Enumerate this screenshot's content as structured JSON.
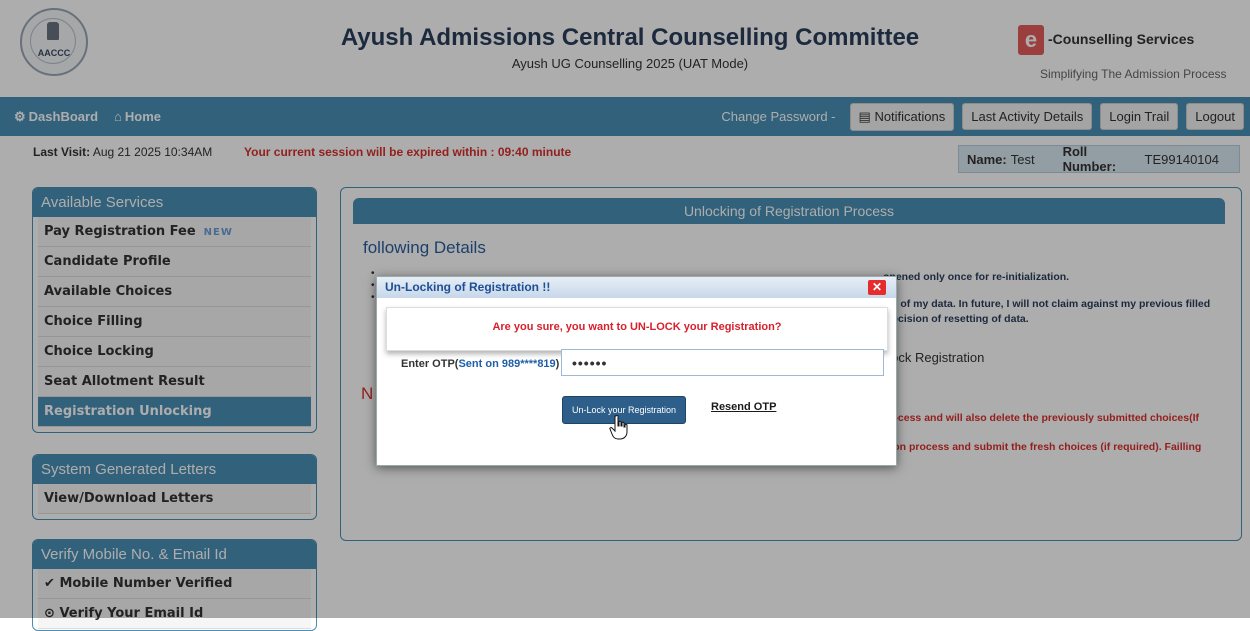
{
  "header": {
    "title": "Ayush Admissions Central Counselling Committee",
    "subtitle": "Ayush UG Counselling 2025 (UAT Mode)",
    "emblem_abbr": "AACCC",
    "brand_mark": "e",
    "brand_name": "-Counselling Services",
    "brand_tagline": "Simplifying The Admission Process"
  },
  "nav": {
    "dashboard": "DashBoard",
    "home": "Home",
    "change_password": "Change Password -",
    "notifications": "Notifications",
    "last_activity": "Last Activity Details",
    "login_trail": "Login Trail",
    "logout": "Logout"
  },
  "info": {
    "last_visit_label": "Last Visit:",
    "last_visit_value": "Aug 21 2025 10:34AM",
    "session_warning": "Your current session will be expired within : 09:40 minute",
    "name_label": "Name:",
    "name_value": "Test",
    "roll_label": "Roll Number:",
    "roll_value": "TE99140104"
  },
  "sidebar": {
    "services_header": "Available Services",
    "services": [
      {
        "label": "Pay Registration Fee",
        "badge": "NEW"
      },
      {
        "label": "Candidate Profile"
      },
      {
        "label": "Available Choices"
      },
      {
        "label": "Choice Filling"
      },
      {
        "label": "Choice Locking"
      },
      {
        "label": "Seat Allotment Result"
      },
      {
        "label": "Registration Unlocking"
      }
    ],
    "letters_header": "System Generated Letters",
    "letters_item": "View/Download Letters",
    "verify_header": "Verify Mobile No. & Email Id",
    "verify_mobile": "Mobile Number Verified",
    "verify_email": "Verify Your Email Id"
  },
  "main": {
    "header": "Unlocking of Registration Process",
    "following": "following Details",
    "bullet1": "opened only once for re-initialization.",
    "bullet2": "g of my data. In future, I will not claim against my previous filled",
    "bullet3": "y decision of resetting of data.",
    "unlock_text": "nlock Registration",
    "note_head": "N",
    "note1": "process and will also delete the previously submitted choices(If",
    "note2": "ation process and submit the fresh choices (if required). Failling"
  },
  "modal": {
    "title": "Un-Locking of Registration !!",
    "confirm": "Are you sure, you want to UN-LOCK your Registration?",
    "otp_label_prefix": "Enter OTP(",
    "otp_label_sent": "Sent on 989****819",
    "otp_label_suffix": ") :",
    "otp_value": "••••••",
    "unlock_button": "Un-Lock your Registration",
    "resend": "Resend OTP"
  },
  "colors": {
    "nav": "#4a8fb6",
    "warning": "#d9302c",
    "button_dark": "#2d5f8a"
  }
}
